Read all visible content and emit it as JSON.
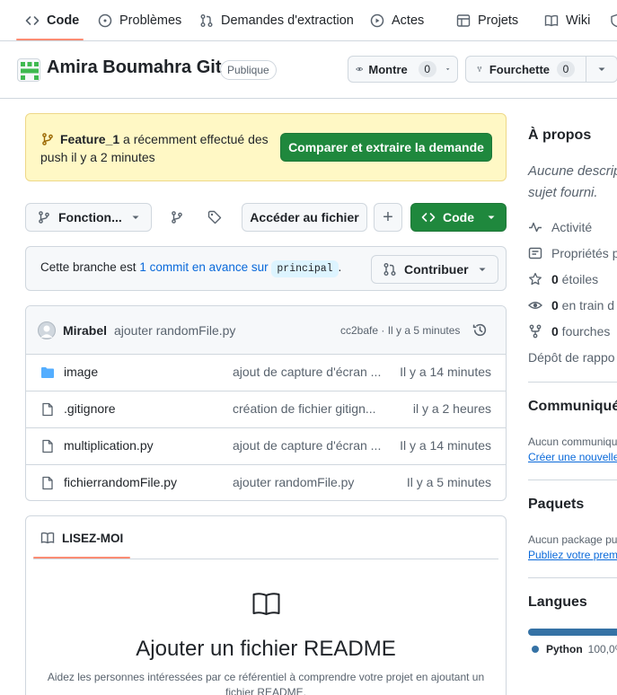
{
  "nav": {
    "tabs": [
      {
        "label": "Code",
        "icon": "code-icon"
      },
      {
        "label": "Problèmes",
        "icon": "issue-icon"
      },
      {
        "label": "Demandes d'extraction",
        "icon": "pull-request-icon"
      },
      {
        "label": "Actes",
        "icon": "play-icon"
      },
      {
        "label": "Projets",
        "icon": "table-icon"
      },
      {
        "label": "Wiki",
        "icon": "book-icon"
      }
    ],
    "active_color": "#fd8c73"
  },
  "repo": {
    "name": "Amira Boumahra Git",
    "visibility": "Publique",
    "watch_label": "Montre",
    "watch_count": "0",
    "fork_label": "Fourchette",
    "fork_count": "0"
  },
  "banner": {
    "branch": "Feature_1",
    "message": " a récemment effectué des",
    "message2": "push il y a 2 minutes",
    "compare_button": "Comparer et extraire la demande"
  },
  "toolbar": {
    "branch_select": "Fonction...",
    "goto_file": "Accéder au fichier",
    "add_symbol": "+",
    "code_button": "Code"
  },
  "branch_info": {
    "prefix": "Cette branche est ",
    "ahead_link": "1 commit en avance sur",
    "base_branch": "principal",
    "suffix": ".",
    "contribute": "Contribuer"
  },
  "latest_commit": {
    "author": "Mirabel",
    "message": "ajouter randomFile.py",
    "meta": "cc2bafe · Il y a 5 minutes"
  },
  "files": [
    {
      "name": "image",
      "type": "folder",
      "message": "ajout de capture d'écran ...",
      "time": "Il y a 14 minutes"
    },
    {
      "name": ".gitignore",
      "type": "file",
      "message": "création de fichier gitign...",
      "time": "il y a 2 heures"
    },
    {
      "name": "multiplication.py",
      "type": "file",
      "message": "ajout de capture d'écran ...",
      "time": "Il y a 14 minutes"
    },
    {
      "name": "fichierrandomFile.py",
      "type": "file",
      "message": "ajouter randomFile.py",
      "time": "Il y a 5 minutes"
    }
  ],
  "readme": {
    "tab_label": "LISEZ-MOI",
    "title": "Ajouter un fichier README",
    "description": "Aidez les personnes intéressées par ce référentiel à comprendre votre projet en ajoutant un",
    "description2": "fichier README."
  },
  "sidebar": {
    "about_title": "À propos",
    "about_desc1": "Aucune descrip",
    "about_desc2": "sujet fourni.",
    "activity": "Activité",
    "properties": "Propriétés p",
    "stars_count": "0",
    "stars_label": " étoiles",
    "watching_count": "0",
    "watching_label": " en train d",
    "forks_count": "0",
    "forks_label": " fourches",
    "report": "Dépôt de rappo",
    "community_title": "Communiqué",
    "community_text": "Aucun communiqu",
    "community_link": "Créer une nouvelle",
    "packages_title": "Paquets",
    "packages_text": "Aucun package pu",
    "packages_link": "Publiez votre prem",
    "languages_title": "Langues",
    "language_name": "Python",
    "language_pct": "100,0%",
    "language_color": "#3572A5"
  },
  "colors": {
    "green": "#1f883d",
    "link": "#0969da",
    "banner_bg": "#fff8c5",
    "border": "#d0d7de"
  }
}
